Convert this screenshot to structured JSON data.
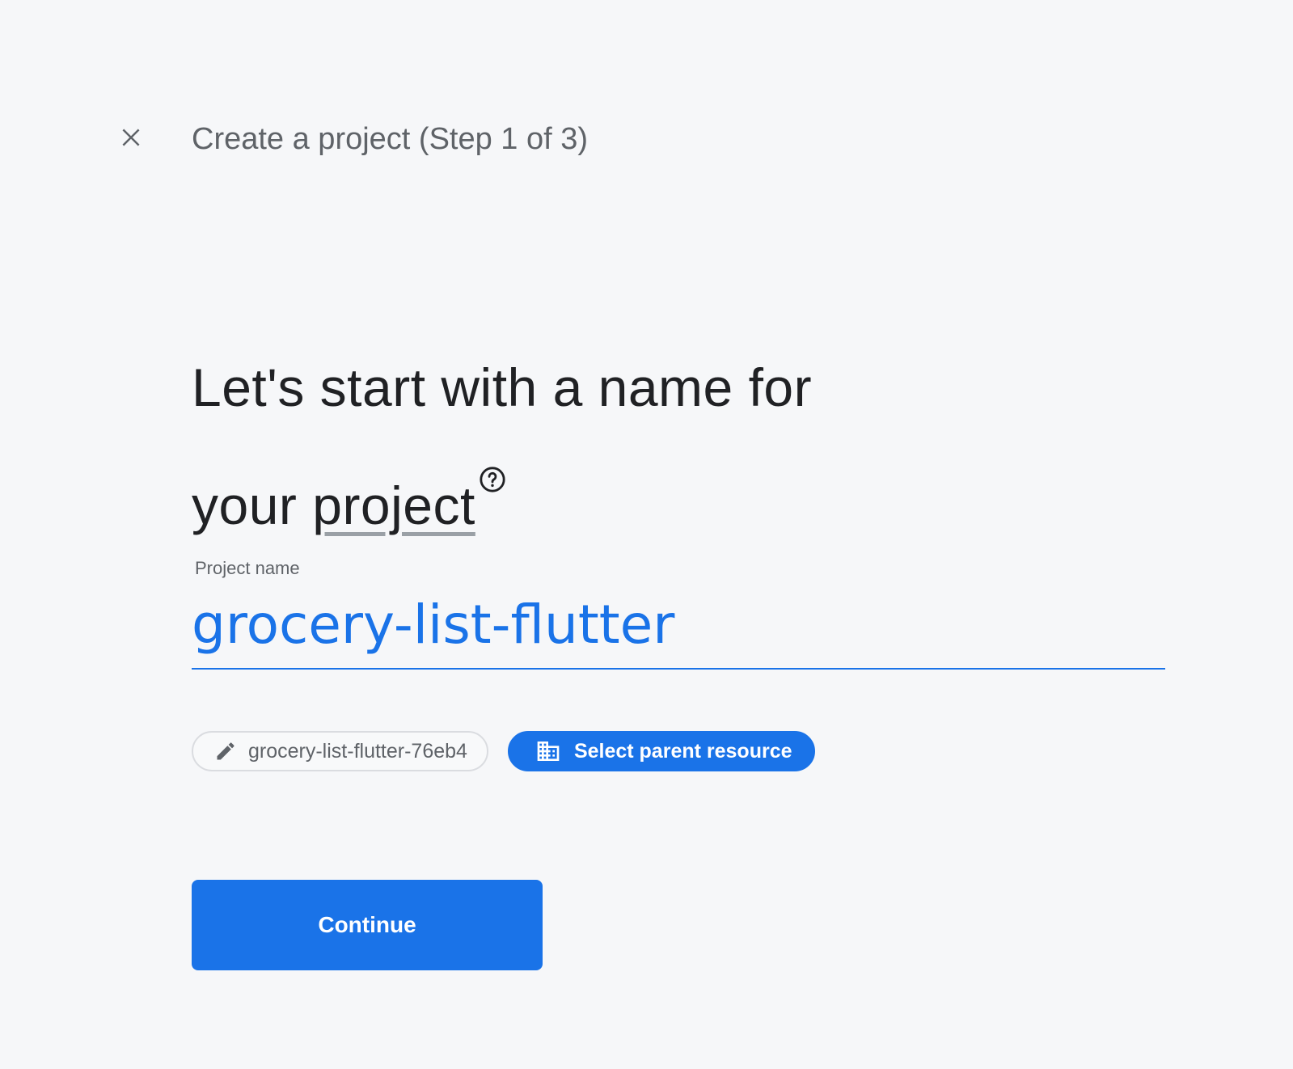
{
  "header": {
    "step_title": "Create a project (Step 1 of 3)"
  },
  "headline": {
    "line1": "Let's start with a name for",
    "line2_prefix": "your ",
    "line2_term": "project"
  },
  "project_name_field": {
    "label": "Project name",
    "value": "grocery-list-flutter"
  },
  "chips": {
    "project_id": "grocery-list-flutter-76eb4",
    "parent_resource": "Select parent resource"
  },
  "actions": {
    "continue_label": "Continue"
  },
  "icons": {
    "close": "close-icon",
    "help": "help-circle-icon",
    "edit": "pencil-icon",
    "organization": "building-icon"
  },
  "colors": {
    "accent": "#1a73e8",
    "background": "#f6f7f9",
    "text_primary": "#202124",
    "text_secondary": "#5f6368"
  }
}
